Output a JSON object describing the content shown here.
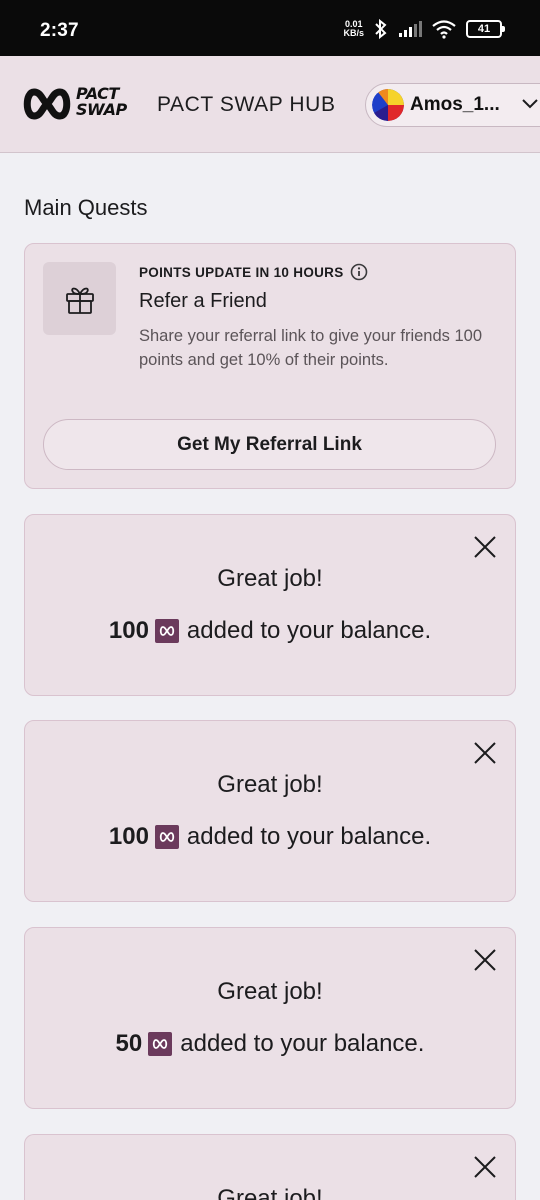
{
  "status_bar": {
    "time": "2:37",
    "net_speed_value": "0.01",
    "net_speed_unit": "KB/s",
    "battery": "41"
  },
  "header": {
    "logo_line1": "PACT",
    "logo_line2": "SWAP",
    "title": "PACT SWAP HUB",
    "user_name": "Amos_1..."
  },
  "main": {
    "section_title": "Main Quests",
    "referral": {
      "points_update": "POINTS UPDATE IN 10 HOURS",
      "title": "Refer a Friend",
      "description": "Share your referral link to give your friends 100 points and get 10% of their points.",
      "button_label": "Get My Referral Link"
    },
    "notices": [
      {
        "heading": "Great job!",
        "amount": "100",
        "suffix": "added to your balance."
      },
      {
        "heading": "Great job!",
        "amount": "100",
        "suffix": "added to your balance."
      },
      {
        "heading": "Great job!",
        "amount": "50",
        "suffix": "added to your balance."
      },
      {
        "heading": "Great job!"
      }
    ]
  },
  "colors": {
    "header_bg": "#ebe0e6",
    "card_bg": "#ebe0e6",
    "page_bg": "#f0f0f4",
    "token": "#6b3a5c"
  }
}
